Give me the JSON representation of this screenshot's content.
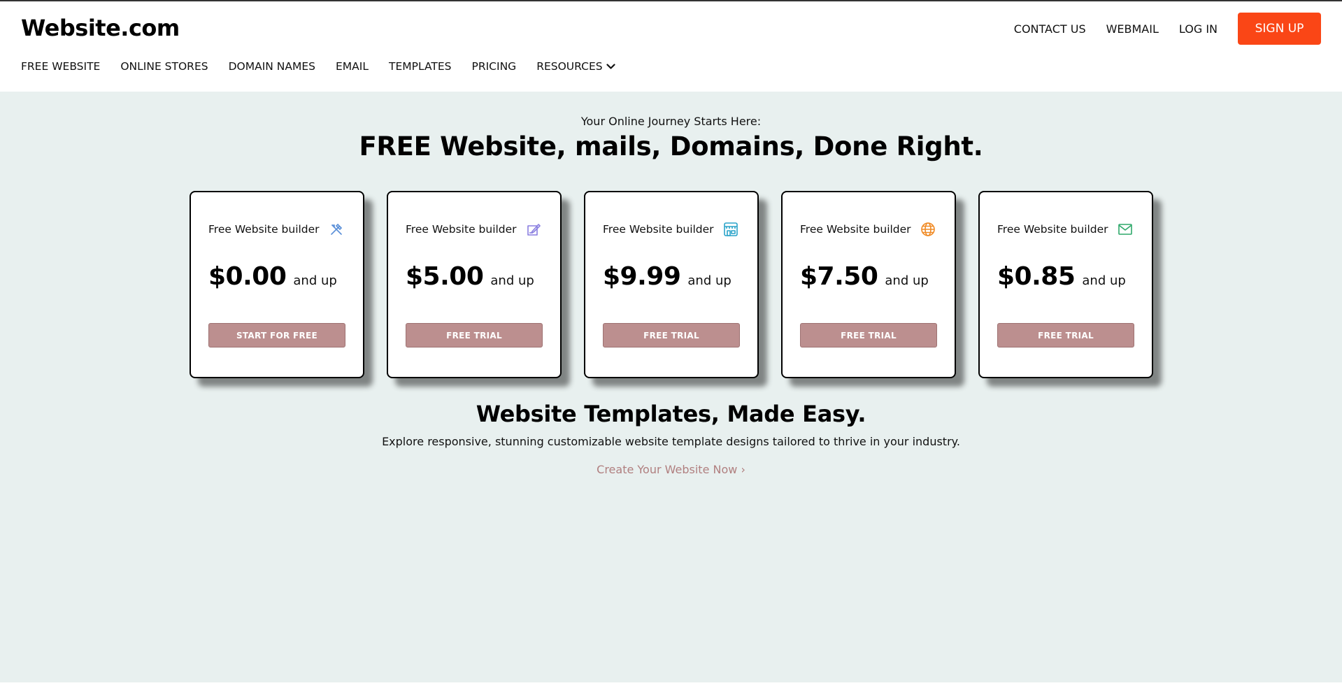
{
  "header": {
    "logo": "Website.com",
    "top_links": [
      "CONTACT US",
      "WEBMAIL",
      "LOG IN"
    ],
    "signup_label": "SIGN UP",
    "nav": [
      "FREE WEBSITE",
      "ONLINE STORES",
      "DOMAIN NAMES",
      "EMAIL",
      "TEMPLATES",
      "PRICING",
      "RESOURCES"
    ]
  },
  "hero": {
    "eyebrow": "Your Online Journey Starts Here:",
    "title": "FREE Website, mails, Domains, Done Right."
  },
  "cards": [
    {
      "label": "Free Website builder",
      "icon": "tools-icon",
      "price": "$0.00",
      "suffix": "and up",
      "cta": "START FOR FREE"
    },
    {
      "label": "Free Website builder",
      "icon": "edit-icon",
      "price": "$5.00",
      "suffix": "and up",
      "cta": "FREE TRIAL"
    },
    {
      "label": "Free Website builder",
      "icon": "store-icon",
      "price": "$9.99",
      "suffix": "and up",
      "cta": "FREE TRIAL"
    },
    {
      "label": "Free Website builder",
      "icon": "globe-icon",
      "price": "$7.50",
      "suffix": "and up",
      "cta": "FREE TRIAL"
    },
    {
      "label": "Free Website builder",
      "icon": "mail-icon",
      "price": "$0.85",
      "suffix": "and up",
      "cta": "FREE TRIAL"
    }
  ],
  "templates": {
    "title": "Website Templates, Made Easy.",
    "subtitle": "Explore responsive, stunning customizable website template designs tailored to thrive in your industry.",
    "link": "Create Your Website Now",
    "link_arrow": "›"
  },
  "colors": {
    "accent": "#fa4616",
    "cta": "#bc8f8f",
    "background": "#e8f0ef",
    "icon_tools": "#5a8fd8",
    "icon_edit": "#8a7fe0",
    "icon_store": "#2aa3c9",
    "icon_globe": "#f08a24",
    "icon_mail": "#2ea86a"
  }
}
